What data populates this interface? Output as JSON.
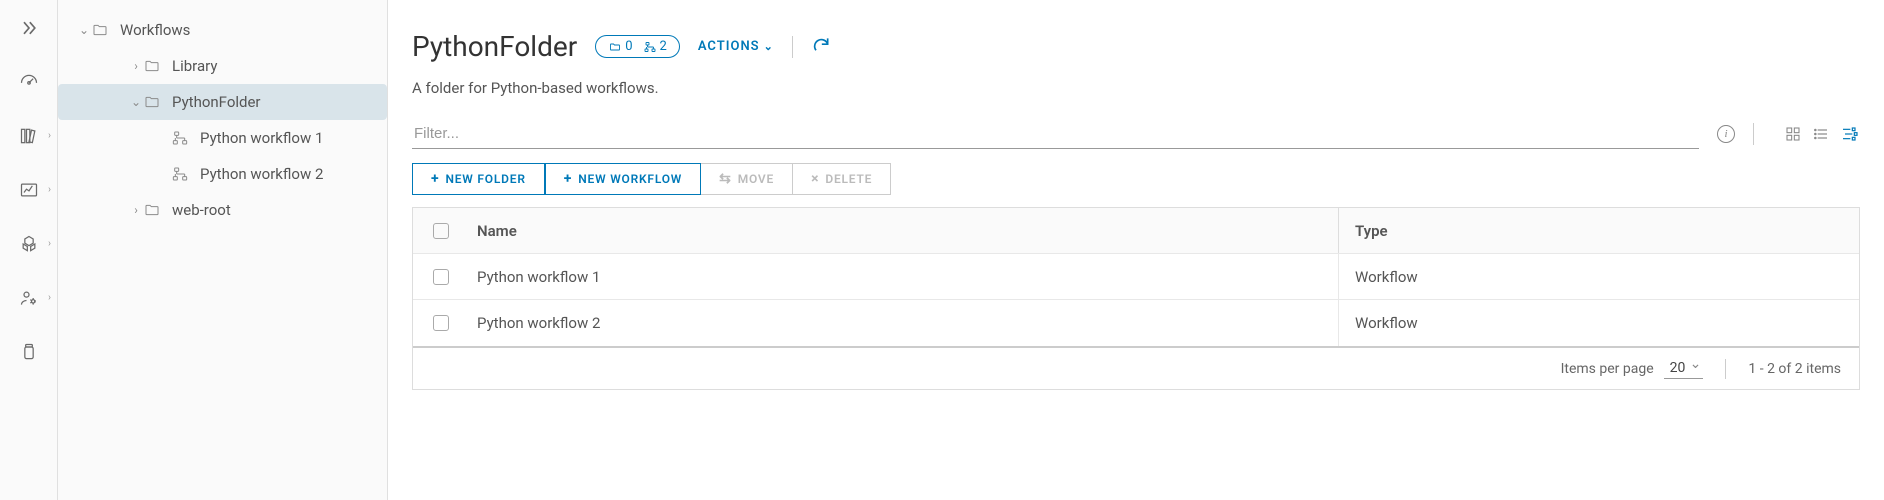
{
  "rail": {
    "items": [
      {
        "name": "expand",
        "caret": false
      },
      {
        "name": "dashboard",
        "caret": false
      },
      {
        "name": "library",
        "caret": true
      },
      {
        "name": "analytics",
        "caret": true
      },
      {
        "name": "packages",
        "caret": true
      },
      {
        "name": "admin",
        "caret": true
      },
      {
        "name": "inventory",
        "caret": false
      }
    ]
  },
  "tree": {
    "root_label": "Workflows",
    "items": [
      {
        "label": "Library",
        "icon": "folder",
        "indent": 1,
        "expanded": false,
        "has_children": true,
        "selected": false
      },
      {
        "label": "PythonFolder",
        "icon": "folder",
        "indent": 1,
        "expanded": true,
        "has_children": true,
        "selected": true
      },
      {
        "label": "Python workflow 1",
        "icon": "workflow",
        "indent": 2,
        "expanded": false,
        "has_children": false,
        "selected": false
      },
      {
        "label": "Python workflow 2",
        "icon": "workflow",
        "indent": 2,
        "expanded": false,
        "has_children": false,
        "selected": false
      },
      {
        "label": "web-root",
        "icon": "folder",
        "indent": 1,
        "expanded": false,
        "has_children": true,
        "selected": false
      }
    ]
  },
  "header": {
    "title": "PythonFolder",
    "badge_folders": "0",
    "badge_workflows": "2",
    "actions_label": "ACTIONS",
    "description": "A folder for Python-based workflows."
  },
  "filter": {
    "placeholder": "Filter..."
  },
  "toolbar": {
    "new_folder": "NEW FOLDER",
    "new_workflow": "NEW WORKFLOW",
    "move": "MOVE",
    "delete": "DELETE"
  },
  "table": {
    "columns": {
      "name": "Name",
      "type": "Type"
    },
    "rows": [
      {
        "name": "Python workflow 1",
        "type": "Workflow"
      },
      {
        "name": "Python workflow 2",
        "type": "Workflow"
      }
    ],
    "footer": {
      "items_per_page_label": "Items per page",
      "items_per_page_value": "20",
      "range": "1 - 2 of 2 items"
    }
  }
}
